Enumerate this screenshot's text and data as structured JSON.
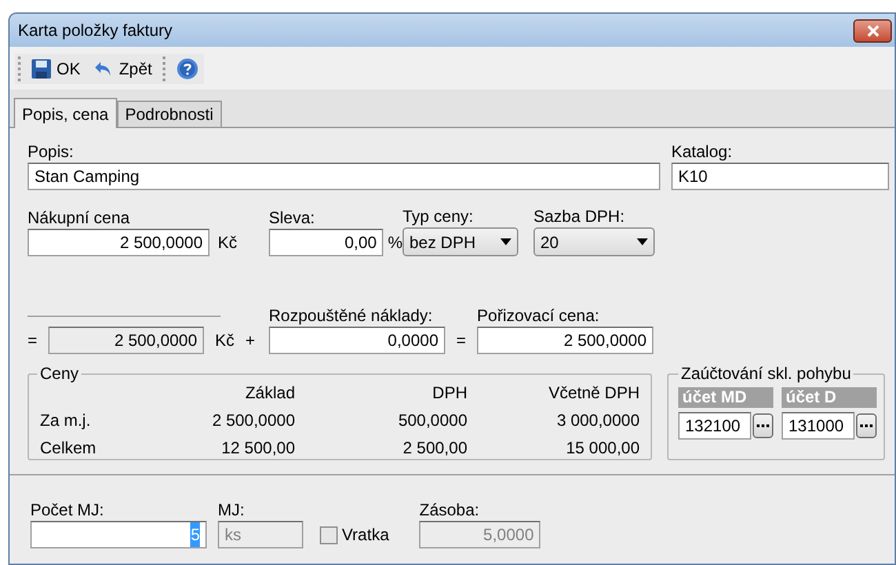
{
  "window": {
    "title": "Karta položky faktury"
  },
  "toolbar": [
    {
      "kind": "save",
      "label": "OK"
    },
    {
      "kind": "undo",
      "label": "Zpět"
    },
    {
      "kind": "help"
    }
  ],
  "tabs": [
    {
      "label": "Popis, cena",
      "selected": true
    },
    {
      "label": "Podrobnosti",
      "selected": false
    }
  ],
  "popis": {
    "label": "Popis:",
    "value": "Stan Camping"
  },
  "katalog": {
    "label": "Katalog:",
    "value": "K10"
  },
  "nakupni_cena": {
    "label": "Nákupní cena",
    "value": "2 500,0000",
    "unit": "Kč"
  },
  "sleva": {
    "label": "Sleva:",
    "value": "0,00",
    "unit": "%"
  },
  "typ_ceny": {
    "label": "Typ ceny:",
    "value": "bez DPH"
  },
  "sazba_dph": {
    "label": "Sazba DPH:",
    "value": "20"
  },
  "calc": {
    "equals": "=",
    "subtotal": {
      "value": "2 500,0000",
      "unit": "Kč",
      "readonly": true
    },
    "plus": "+",
    "naklady": {
      "label": "Rozpouštěné náklady:",
      "value": "0,0000"
    },
    "equals2": "=",
    "porizovaci": {
      "label": "Pořizovací cena:",
      "value": "2 500,0000"
    }
  },
  "ceny": {
    "title": "Ceny",
    "columns": [
      "Základ",
      "DPH",
      "Včetně DPH"
    ],
    "rows": [
      {
        "label": "Za m.j.",
        "values": [
          "2 500,0000",
          "500,0000",
          "3 000,0000"
        ]
      },
      {
        "label": "Celkem",
        "values": [
          "12 500,00",
          "2 500,00",
          "15 000,00"
        ]
      }
    ]
  },
  "zauctovani": {
    "title": "Zaúčtování skl. pohybu",
    "accounts": [
      {
        "header": "účet MD",
        "value": "132100"
      },
      {
        "header": "účet D",
        "value": "131000"
      }
    ]
  },
  "bottom": {
    "pocet": {
      "label": "Počet MJ:",
      "value": "5"
    },
    "mj": {
      "label": "MJ:",
      "value": "ks",
      "disabled": true
    },
    "vratka": {
      "label": "Vratka",
      "checked": false
    },
    "zasoba": {
      "label": "Zásoba:",
      "value": "5,0000",
      "disabled": true
    }
  }
}
